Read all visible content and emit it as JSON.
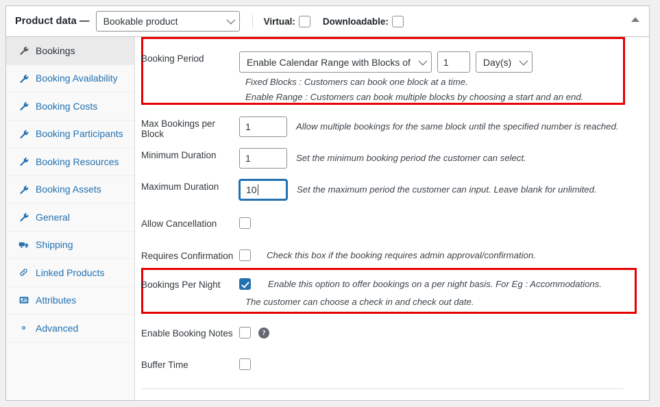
{
  "header": {
    "title": "Product data —",
    "product_type": {
      "value": "Bookable product",
      "icon": "chevron-down-icon"
    },
    "virtual": {
      "label": "Virtual:",
      "checked": false
    },
    "downloadable": {
      "label": "Downloadable:",
      "checked": false
    },
    "collapse_icon": "triangle-up-icon"
  },
  "sidebar": {
    "items": [
      {
        "label": "Bookings",
        "icon": "wrench-icon",
        "active": true
      },
      {
        "label": "Booking Availability",
        "icon": "wrench-icon",
        "active": false
      },
      {
        "label": "Booking Costs",
        "icon": "wrench-icon",
        "active": false
      },
      {
        "label": "Booking Participants",
        "icon": "wrench-icon",
        "active": false
      },
      {
        "label": "Booking Resources",
        "icon": "wrench-icon",
        "active": false
      },
      {
        "label": "Booking Assets",
        "icon": "wrench-icon",
        "active": false
      },
      {
        "label": "General",
        "icon": "wrench-icon",
        "active": false
      },
      {
        "label": "Shipping",
        "icon": "truck-icon",
        "active": false
      },
      {
        "label": "Linked Products",
        "icon": "link-icon",
        "active": false
      },
      {
        "label": "Attributes",
        "icon": "list-view-icon",
        "active": false
      },
      {
        "label": "Advanced",
        "icon": "gear-icon",
        "active": false
      }
    ]
  },
  "main": {
    "booking_period": {
      "label": "Booking Period",
      "mode_select": "Enable Calendar Range with Blocks of",
      "amount": "1",
      "unit_select": "Day(s)",
      "hint_line1": "Fixed Blocks : Customers can book one block at a time.",
      "hint_line2": "Enable Range : Customers can book multiple blocks by choosing a start and an end.",
      "highlighted": true
    },
    "max_bookings_per_block": {
      "label": "Max Bookings per Block",
      "value": "1",
      "hint": "Allow multiple bookings for the same block until the specified number is reached."
    },
    "minimum_duration": {
      "label": "Minimum Duration",
      "value": "1",
      "hint": "Set the minimum booking period the customer can select."
    },
    "maximum_duration": {
      "label": "Maximum Duration",
      "value": "10",
      "focused": true,
      "hint": "Set the maximum period the customer can input. Leave blank for unlimited."
    },
    "allow_cancellation": {
      "label": "Allow Cancellation",
      "checked": false,
      "hint": ""
    },
    "requires_confirmation": {
      "label": "Requires Confirmation",
      "checked": false,
      "hint": "Check this box if the booking requires admin approval/confirmation."
    },
    "bookings_per_night": {
      "label": "Bookings Per Night",
      "checked": true,
      "hint_line1": "Enable this option to offer bookings on a per night basis. For Eg : Accommodations.",
      "hint_line2": "The customer can choose a check in and check out date.",
      "highlighted": true
    },
    "enable_booking_notes": {
      "label": "Enable Booking Notes",
      "checked": false,
      "help_icon": "question-mark-icon"
    },
    "buffer_time": {
      "label": "Buffer Time",
      "checked": false
    }
  },
  "colors": {
    "highlight": "#e60000",
    "link": "#2271b1",
    "panel_border": "#c3c4c7"
  }
}
